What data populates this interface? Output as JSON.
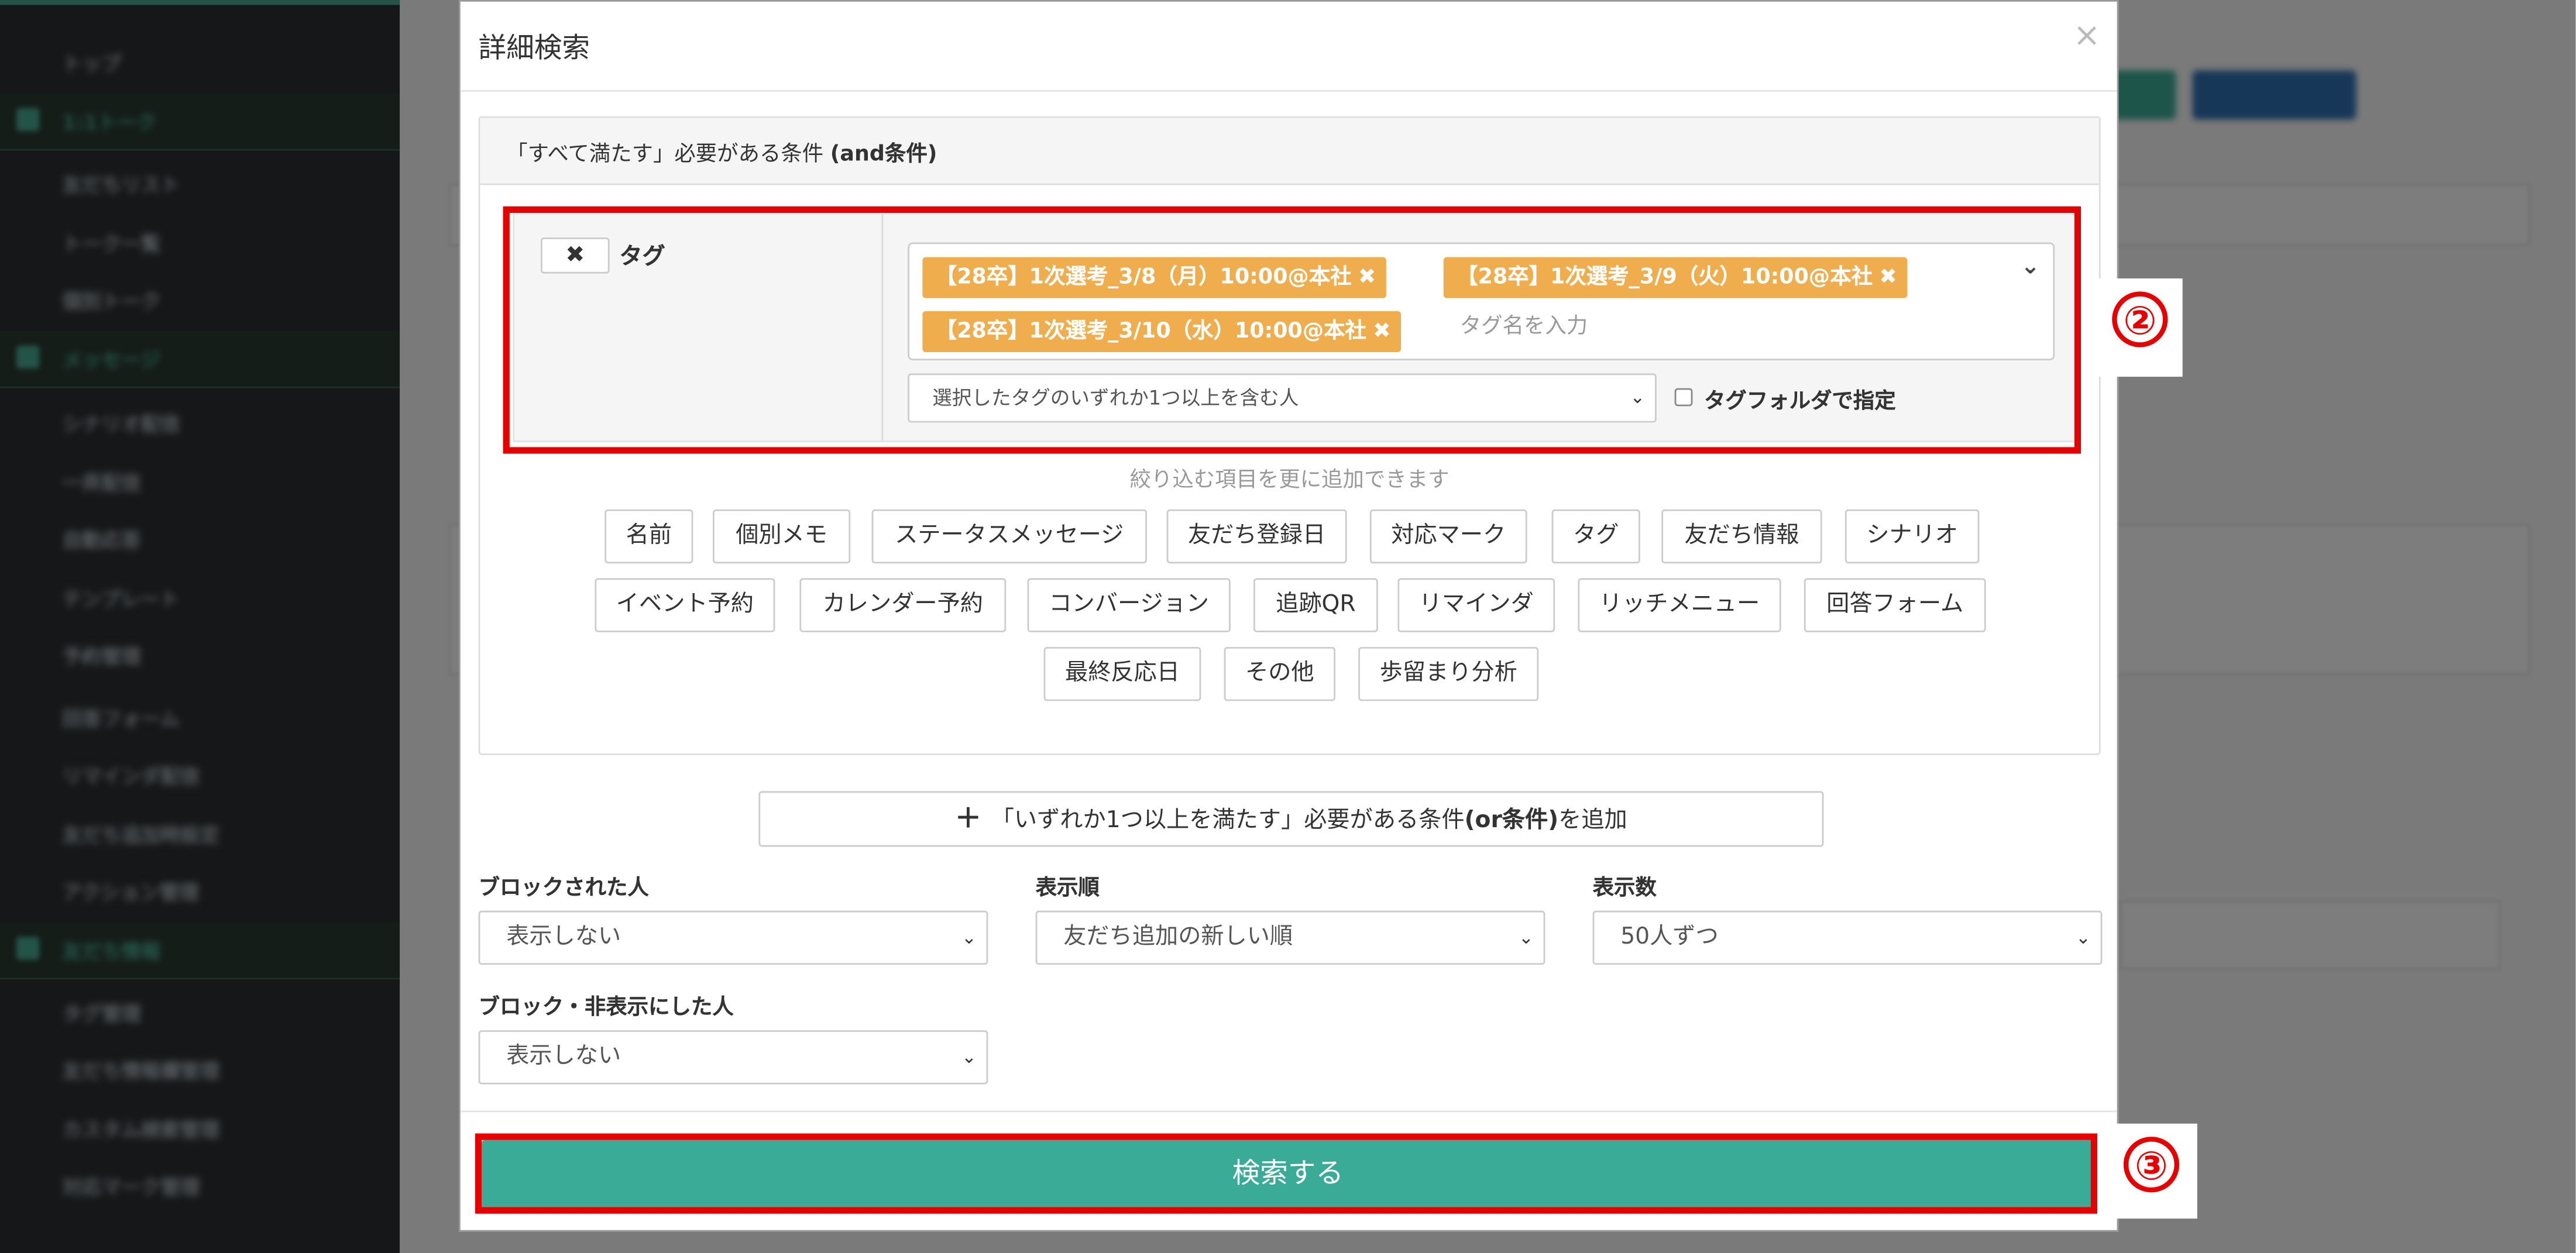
{
  "sidebar": {
    "items": [
      "トップ",
      "1:1トーク",
      "友だちリスト",
      "トーク一覧",
      "個別トーク",
      "メッセージ",
      "シナリオ配信",
      "一斉配信",
      "自動応答",
      "テンプレート",
      "予約管理",
      "回答フォーム",
      "リマインダ配信",
      "友だち追加時設定",
      "アクション管理",
      "友だち情報",
      "タグ管理",
      "友だち情報欄管理",
      "カスタム検索管理",
      "対応マーク管理"
    ]
  },
  "modal": {
    "title": "詳細検索",
    "close": "×",
    "and_panel": {
      "header_prefix": "「すべて満たす」必要がある条件 ",
      "header_bold": "(and条件)",
      "condition": {
        "remove": "✖",
        "label": "タグ",
        "tags": [
          {
            "text": "【28卒】1次選考_3/8（月）10:00@本社",
            "x": "✖"
          },
          {
            "text": "【28卒】1次選考_3/9（火）10:00@本社",
            "x": "✖"
          },
          {
            "text": "【28卒】1次選考_3/10（水）10:00@本社",
            "x": "✖"
          }
        ],
        "tag_placeholder": "タグ名を入力",
        "match_select": "選択したタグのいずれか1つ以上を含む人",
        "folder_checkbox": "タグフォルダで指定"
      },
      "hint": "絞り込む項目を更に追加できます",
      "filter_buttons": [
        "名前",
        "個別メモ",
        "ステータスメッセージ",
        "友だち登録日",
        "対応マーク",
        "タグ",
        "友だち情報",
        "シナリオ",
        "イベント予約",
        "カレンダー予約",
        "コンバージョン",
        "追跡QR",
        "リマインダ",
        "リッチメニュー",
        "回答フォーム",
        "最終反応日",
        "その他",
        "歩留まり分析"
      ]
    },
    "or_button": {
      "plus": "＋",
      "prefix": "「いずれか1つ以上を満たす」必要がある条件",
      "bold": "(or条件)",
      "suffix": "を追加"
    },
    "blocked": {
      "label": "ブロックされた人",
      "value": "表示しない"
    },
    "order": {
      "label": "表示順",
      "value": "友だち追加の新しい順"
    },
    "count": {
      "label": "表示数",
      "value": "50人ずつ"
    },
    "hidden": {
      "label": "ブロック・非表示にした人",
      "value": "表示しない"
    },
    "search_button": "検索する"
  },
  "annotations": {
    "two": "②",
    "three": "③"
  },
  "colors": {
    "accent": "#3aab96",
    "tag_chip": "#f0ad4e",
    "highlight": "#e60000"
  }
}
